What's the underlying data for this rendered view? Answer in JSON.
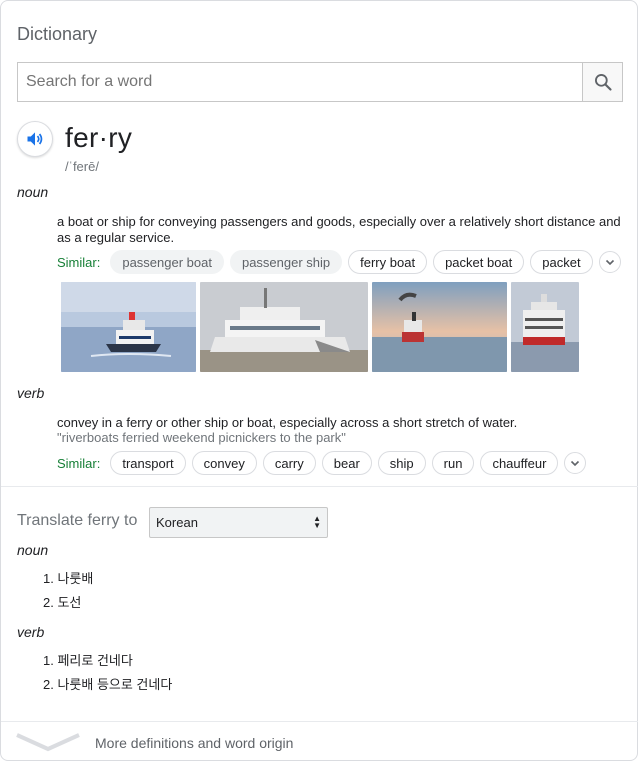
{
  "header": {
    "title": "Dictionary"
  },
  "search": {
    "placeholder": "Search for a word",
    "value": ""
  },
  "entry": {
    "word": "fer·ry",
    "phonetic": "/ˈferē/"
  },
  "noun": {
    "pos_label": "noun",
    "definition": "a boat or ship for conveying passengers and goods, especially over a relatively short distance and as a regular service.",
    "similar_label": "Similar:",
    "similar": [
      "passenger boat",
      "passenger ship",
      "ferry boat",
      "packet boat",
      "packet"
    ]
  },
  "verb": {
    "pos_label": "verb",
    "definition": "convey in a ferry or other ship or boat, especially across a short stretch of water.",
    "example": "\"riverboats ferried weekend picnickers to the park\"",
    "similar_label": "Similar:",
    "similar": [
      "transport",
      "convey",
      "carry",
      "bear",
      "ship",
      "run",
      "chauffeur"
    ]
  },
  "translate": {
    "label": "Translate ferry to",
    "language": "Korean",
    "noun_label": "noun",
    "noun_items": [
      "1. 나룻배",
      "2. 도선"
    ],
    "verb_label": "verb",
    "verb_items": [
      "1. 페리로 건네다",
      "2. 나룻배 등으로 건네다"
    ]
  },
  "footer": {
    "more_label": "More definitions and word origin"
  },
  "colors": {
    "similar_green": "#188038",
    "accent_blue": "#1a73e8",
    "muted": "#70757a"
  }
}
